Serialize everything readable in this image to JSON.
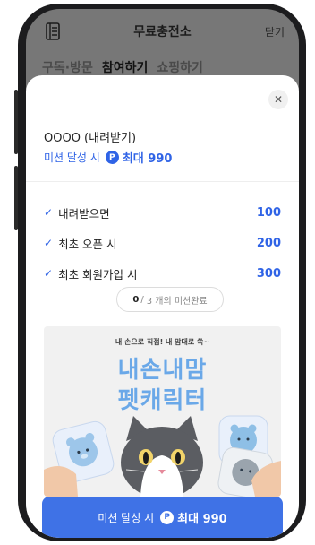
{
  "appbar": {
    "menu_icon": "list-icon",
    "title": "무료충전소",
    "close_label": "닫기"
  },
  "tabs": [
    {
      "label": "구독·방문",
      "active": false
    },
    {
      "label": "참여하기",
      "active": true
    },
    {
      "label": "쇼핑하기",
      "active": false
    }
  ],
  "sheet": {
    "close_icon": "close-icon",
    "app_name": "OOOO (내려받기)",
    "reward_prefix": "미션 달성 시",
    "point_icon": "P",
    "reward_amount": "최대 990",
    "missions": [
      {
        "label": "내려받으면",
        "value": "100"
      },
      {
        "label": "최초 오픈 시",
        "value": "200"
      },
      {
        "label": "최초 회원가입 시",
        "value": "300"
      }
    ],
    "progress": {
      "done": "0",
      "sep": "/",
      "total_text": "3 개의 미션완료"
    },
    "banner": {
      "tagline": "내 손으로 직접! 내 맘대로 쏙~",
      "title_line1": "내손내맘",
      "title_line2": "펫캐릭터"
    },
    "cta": {
      "prefix": "미션 달성 시",
      "point_icon": "P",
      "amount": "최대 990"
    }
  },
  "colors": {
    "accent": "#2f63e6",
    "cta": "#3f72e6",
    "banner_title": "#6aa8e8"
  }
}
